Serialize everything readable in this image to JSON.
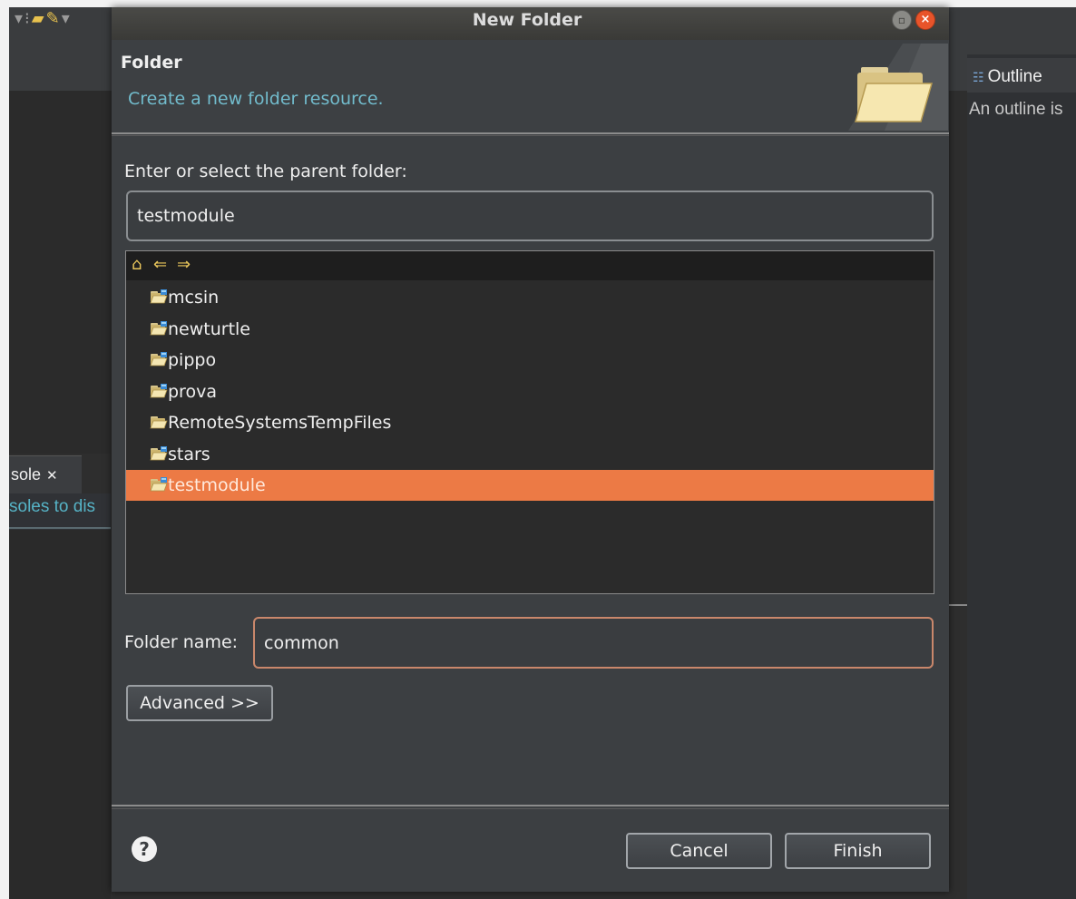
{
  "dialog": {
    "title": "New Folder",
    "heading": "Folder",
    "description": "Create a new folder resource.",
    "parent_label": "Enter or select the parent folder:",
    "parent_value": "testmodule",
    "folder_name_label": "Folder name:",
    "folder_name_value": "common",
    "advanced_label": "Advanced >>",
    "cancel_label": "Cancel",
    "finish_label": "Finish",
    "help_glyph": "?",
    "restore_glyph": "▫",
    "close_glyph": "×"
  },
  "tree": {
    "items": [
      {
        "label": "mcsin",
        "icon": "project-folder-icon"
      },
      {
        "label": "newturtle",
        "icon": "project-folder-icon"
      },
      {
        "label": "pippo",
        "icon": "project-folder-icon"
      },
      {
        "label": "prova",
        "icon": "project-folder-icon"
      },
      {
        "label": "RemoteSystemsTempFiles",
        "icon": "folder-icon"
      },
      {
        "label": "stars",
        "icon": "project-folder-icon"
      },
      {
        "label": "testmodule",
        "icon": "project-folder-icon",
        "selected": true
      }
    ],
    "nav": {
      "home_glyph": "⌂",
      "back_glyph": "⇐",
      "forward_glyph": "⇒"
    }
  },
  "background": {
    "console_tab": "sole",
    "console_message": "soles to dis",
    "outline_tab": "Outline",
    "outline_message": "An outline is"
  },
  "colors": {
    "selection": "#ec7a45",
    "link_text": "#72bccd",
    "close_button": "#e8542a"
  }
}
